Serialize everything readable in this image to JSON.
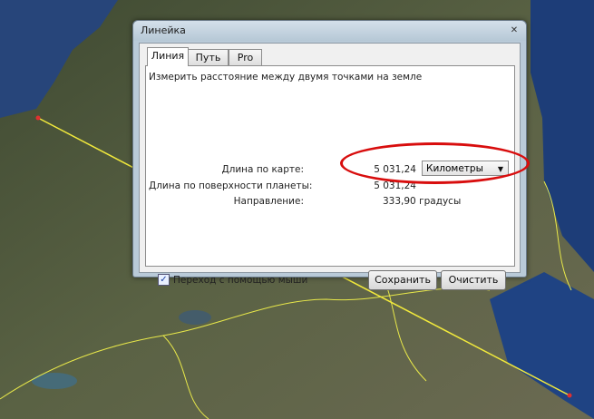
{
  "window": {
    "title": "Линейка",
    "close_glyph": "✕"
  },
  "tabs": [
    "Линия",
    "Путь",
    "Pro"
  ],
  "description": "Измерить расстояние между двумя точками на земле",
  "measurements": {
    "map_length_label": "Длина по карте:",
    "map_length_value": "5 031,24",
    "surface_length_label": "Длина по поверхности планеты:",
    "surface_length_value": "5 031,24",
    "heading_label": "Направление:",
    "heading_value": "333,90 градусы"
  },
  "units_select": {
    "selected": "Километры",
    "arrow": "▼"
  },
  "mouse_nav": {
    "checked_glyph": "✓",
    "label": "Переход с помощью мыши"
  },
  "buttons": {
    "save": "Сохранить",
    "clear": "Очистить"
  },
  "colors": {
    "measure_line": "#f2ea3c",
    "highlight": "#d80d0d",
    "border_lines": "#e8e84a"
  }
}
